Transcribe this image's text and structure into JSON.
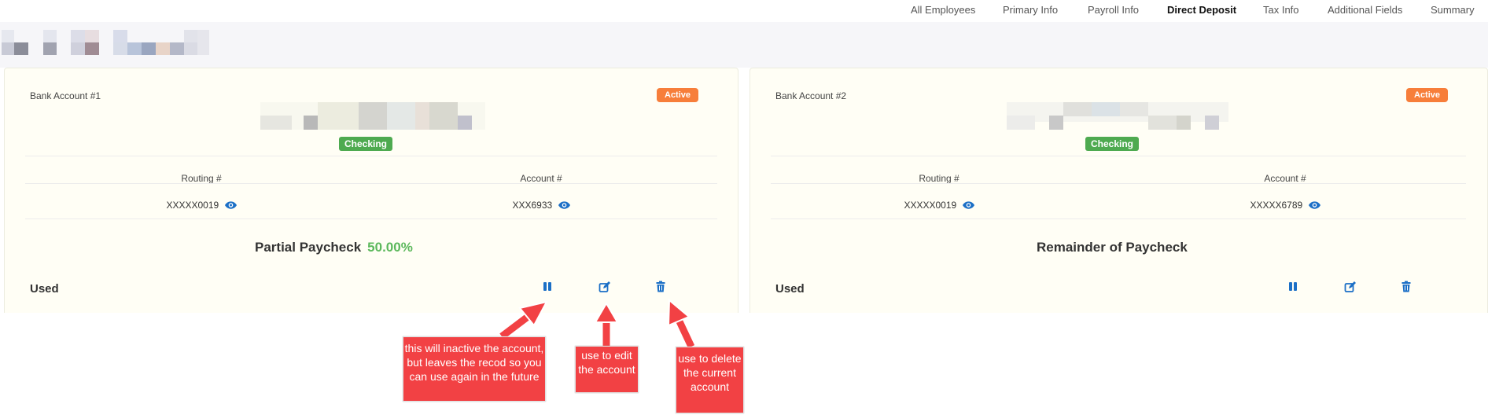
{
  "nav": {
    "tabs": [
      {
        "label": "All Employees",
        "active": false
      },
      {
        "label": "Primary Info",
        "active": false
      },
      {
        "label": "Payroll Info",
        "active": false
      },
      {
        "label": "Direct Deposit",
        "active": true
      },
      {
        "label": "Tax Info",
        "active": false
      },
      {
        "label": "Additional Fields",
        "active": false
      },
      {
        "label": "Summary",
        "active": false
      }
    ]
  },
  "accounts": [
    {
      "title": "Bank Account #1",
      "status": "Active",
      "type": "Checking",
      "routing_label": "Routing #",
      "routing_value": "XXXXX0019",
      "account_label": "Account #",
      "account_value": "XXX6933",
      "paycheck_label": "Partial Paycheck",
      "paycheck_percent": "50.00%",
      "used_label": "Used"
    },
    {
      "title": "Bank Account #2",
      "status": "Active",
      "type": "Checking",
      "routing_label": "Routing #",
      "routing_value": "XXXXX0019",
      "account_label": "Account #",
      "account_value": "XXXXX6789",
      "paycheck_label": "Remainder of Paycheck",
      "used_label": "Used"
    }
  ],
  "callouts": {
    "inactive": "this will inactive the account, but leaves the recod so you can use again in the future",
    "edit": "use to edit the account",
    "delete": "use to delete the current account"
  },
  "colors": {
    "accent_blue": "#1b6fc6",
    "active_badge": "#f77e3a",
    "checking_badge": "#4eaa50",
    "percent_green": "#5cb85c",
    "callout_red": "#f24144",
    "card_bg": "#fffef5"
  },
  "icons": [
    "eye-icon",
    "pause-icon",
    "edit-icon",
    "trash-icon"
  ]
}
